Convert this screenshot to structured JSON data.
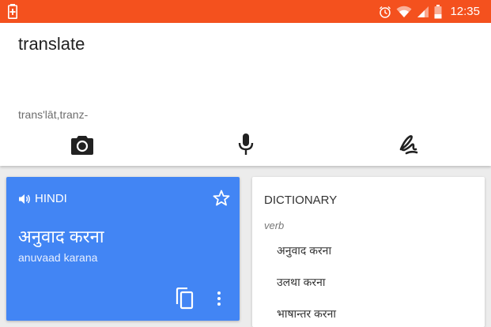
{
  "status_bar": {
    "time": "12:35",
    "icons": [
      "battery-charging-icon",
      "alarm-icon",
      "wifi-icon",
      "signal-icon",
      "battery-icon"
    ],
    "color": "#f4511e"
  },
  "input": {
    "source_text": "translate",
    "phonetic": "trans'lāt,tranz-",
    "tools": [
      "camera-icon",
      "microphone-icon",
      "handwriting-icon"
    ]
  },
  "result": {
    "language": "HINDI",
    "translation": "अनुवाद करना",
    "transliteration": "anuvaad karana",
    "color": "#4285f4"
  },
  "dictionary": {
    "title": "DICTIONARY",
    "part_of_speech": "verb",
    "entries": [
      "अनुवाद करना",
      "उलथा करना",
      "भाषान्तर करना"
    ]
  }
}
